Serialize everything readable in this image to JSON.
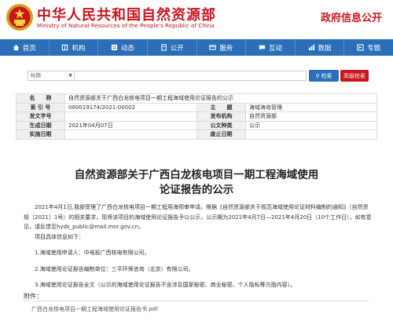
{
  "header": {
    "title_cn": "中华人民共和国自然资源部",
    "title_en": "Ministry of Natural Resources of the People's Republic of China",
    "gov_info": "政府信息公开"
  },
  "nav": {
    "items": [
      {
        "label": "首页",
        "icon": "home-icon"
      },
      {
        "label": "机构",
        "icon": "org-icon"
      },
      {
        "label": "动态",
        "icon": "news-icon"
      },
      {
        "label": "公开",
        "icon": "doc-icon"
      },
      {
        "label": "服务",
        "icon": "service-icon"
      },
      {
        "label": "互动",
        "icon": "chat-icon"
      },
      {
        "label": "数据",
        "icon": "data-icon"
      },
      {
        "label": "专题",
        "icon": "topic-icon"
      }
    ]
  },
  "search": {
    "select_value": "标题",
    "search_label": "检索",
    "advanced_label": "高级检索"
  },
  "meta": {
    "rows": [
      {
        "l1": "名　　称",
        "v1": "自然资源部关于广西白龙核电项目一期工程海域使用论证报告的公示",
        "l2": "",
        "v2": ""
      },
      {
        "l1": "索 引 号",
        "v1": "000019174/2021-00002",
        "l2": "主　　题",
        "v2": "海域海岛管理"
      },
      {
        "l1": "发文字号",
        "v1": "",
        "l2": "发布机构",
        "v2": "自然资源部"
      },
      {
        "l1": "生成日期",
        "v1": "2021年04月07日",
        "l2": "公文种类",
        "v2": "公示"
      },
      {
        "l1": "实施日期",
        "v1": "",
        "l2": "废止日期",
        "v2": ""
      }
    ]
  },
  "article": {
    "title_line1": "自然资源部关于广西白龙核电项目一期工程海域使用",
    "title_line2": "论证报告的公示",
    "para1": "2021年4月1日,我部受理了广西白龙核电项目一期工程用海预审申请。根据《自然资源部关于规范海域使用论证材料编制的通知》（自然资规〔2021〕1号）的相关要求，现将该项目的海域使用论证报告予以公示，公示期为2021年4月7日—2021年4月20日（10个工作日），如有意见，请反馈至hyds_public@mail.mnr.gov.cn。",
    "para2": "项目具体信息如下：",
    "item1": "1.海域使用申请人：中电投广西核电有限公司。",
    "item2": "2.海域使用论证报告编制单位：三平环保咨询（北京）有限公司。",
    "item3": "3.海域使用论证报告全文（公示的海域使用论证报告不含涉及国家秘密、商业秘密、个人隐私等方面内容）。"
  },
  "attachments": {
    "label": "附件：",
    "files": [
      "广西白龙核电项目一期工程海域使用论证报告书.pdf"
    ]
  },
  "colors": {
    "brand_red": "#c8161d",
    "nav_blue": "#2a6fb8"
  }
}
